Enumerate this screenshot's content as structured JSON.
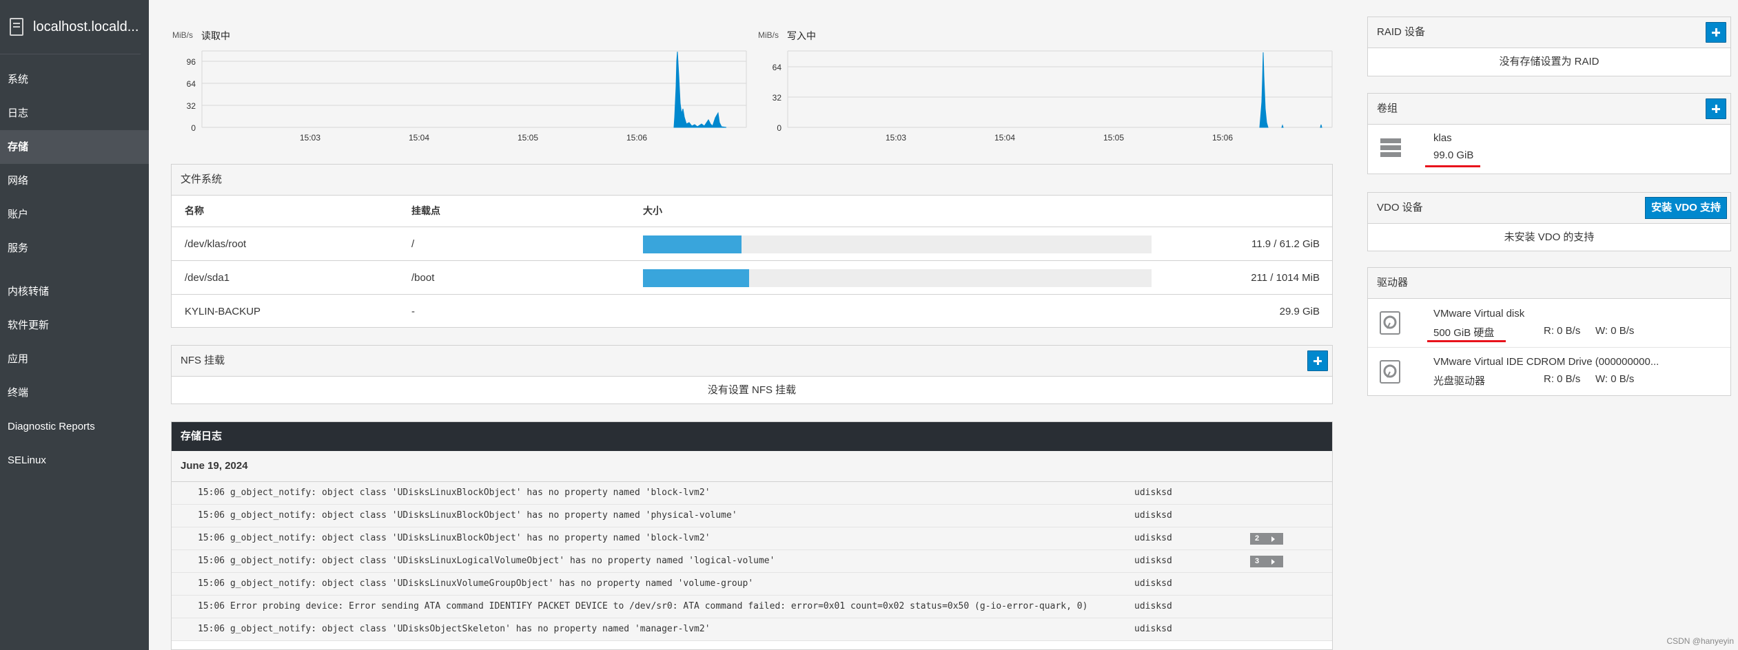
{
  "sidebar": {
    "host": "localhost.locald...",
    "items": [
      "系统",
      "日志",
      "存储",
      "网络",
      "账户",
      "服务",
      "内核转储",
      "软件更新",
      "应用",
      "终端",
      "Diagnostic Reports",
      "SELinux"
    ],
    "active": "存储"
  },
  "graphs": {
    "read": {
      "unit": "MiB/s",
      "title": "读取中",
      "y_ticks": [
        "96",
        "64",
        "32",
        "0"
      ],
      "x_ticks": [
        "15:03",
        "15:04",
        "15:05",
        "15:06"
      ]
    },
    "write": {
      "unit": "MiB/s",
      "title": "写入中",
      "y_ticks": [
        "64",
        "32",
        "0"
      ],
      "x_ticks": [
        "15:03",
        "15:04",
        "15:05",
        "15:06"
      ]
    }
  },
  "filesystems": {
    "title": "文件系统",
    "columns": [
      "名称",
      "挂载点",
      "大小"
    ],
    "rows": [
      {
        "name": "/dev/klas/root",
        "mount": "/",
        "size": "11.9 / 61.2 GiB",
        "fraction": 0.194
      },
      {
        "name": "/dev/sda1",
        "mount": "/boot",
        "size": "211 / 1014 MiB",
        "fraction": 0.208
      },
      {
        "name": "KYLIN-BACKUP",
        "mount": "-",
        "size": "29.9 GiB"
      }
    ]
  },
  "nfs": {
    "title": "NFS 挂载",
    "empty": "没有设置 NFS 挂载"
  },
  "logs": {
    "title": "存储日志",
    "date": "June 19, 2024",
    "rows": [
      {
        "msg": "15:06 g_object_notify: object class 'UDisksLinuxBlockObject' has no property named 'block-lvm2'",
        "svc": "udisksd",
        "count": ""
      },
      {
        "msg": "15:06 g_object_notify: object class 'UDisksLinuxBlockObject' has no property named 'physical-volume'",
        "svc": "udisksd",
        "count": ""
      },
      {
        "msg": "15:06 g_object_notify: object class 'UDisksLinuxBlockObject' has no property named 'block-lvm2'",
        "svc": "udisksd",
        "count": "2"
      },
      {
        "msg": "15:06 g_object_notify: object class 'UDisksLinuxLogicalVolumeObject' has no property named 'logical-volume'",
        "svc": "udisksd",
        "count": "3"
      },
      {
        "msg": "15:06 g_object_notify: object class 'UDisksLinuxVolumeGroupObject' has no property named 'volume-group'",
        "svc": "udisksd",
        "count": ""
      },
      {
        "msg": "15:06 Error probing device: Error sending ATA command IDENTIFY PACKET DEVICE to /dev/sr0: ATA command failed: error=0x01 count=0x02 status=0x50 (g-io-error-quark, 0)",
        "svc": "udisksd",
        "count": ""
      },
      {
        "msg": "15:06 g_object_notify: object class 'UDisksObjectSkeleton' has no property named 'manager-lvm2'",
        "svc": "udisksd",
        "count": ""
      }
    ]
  },
  "raid": {
    "title": "RAID 设备",
    "empty": "没有存储设置为 RAID"
  },
  "vg": {
    "title": "卷组",
    "name": "klas",
    "size": "99.0 GiB"
  },
  "vdo": {
    "title": "VDO 设备",
    "button": "安装 VDO 支持",
    "empty": "未安装 VDO 的支持"
  },
  "drives": {
    "title": "驱动器",
    "items": [
      {
        "name": "VMware Virtual disk",
        "type": "500 GiB 硬盘",
        "read": "R: 0 B/s",
        "write": "W: 0 B/s"
      },
      {
        "name": "VMware Virtual IDE CDROM Drive (000000000...",
        "type": "光盘驱动器",
        "read": "R: 0 B/s",
        "write": "W: 0 B/s"
      }
    ]
  },
  "watermark": "CSDN @hanyeyin",
  "colors": {
    "accent": "#0088ce",
    "sidebar": "#393f44",
    "chart": "#0088ce",
    "bar": "#39a5dc",
    "annotation": "#e8121b"
  }
}
